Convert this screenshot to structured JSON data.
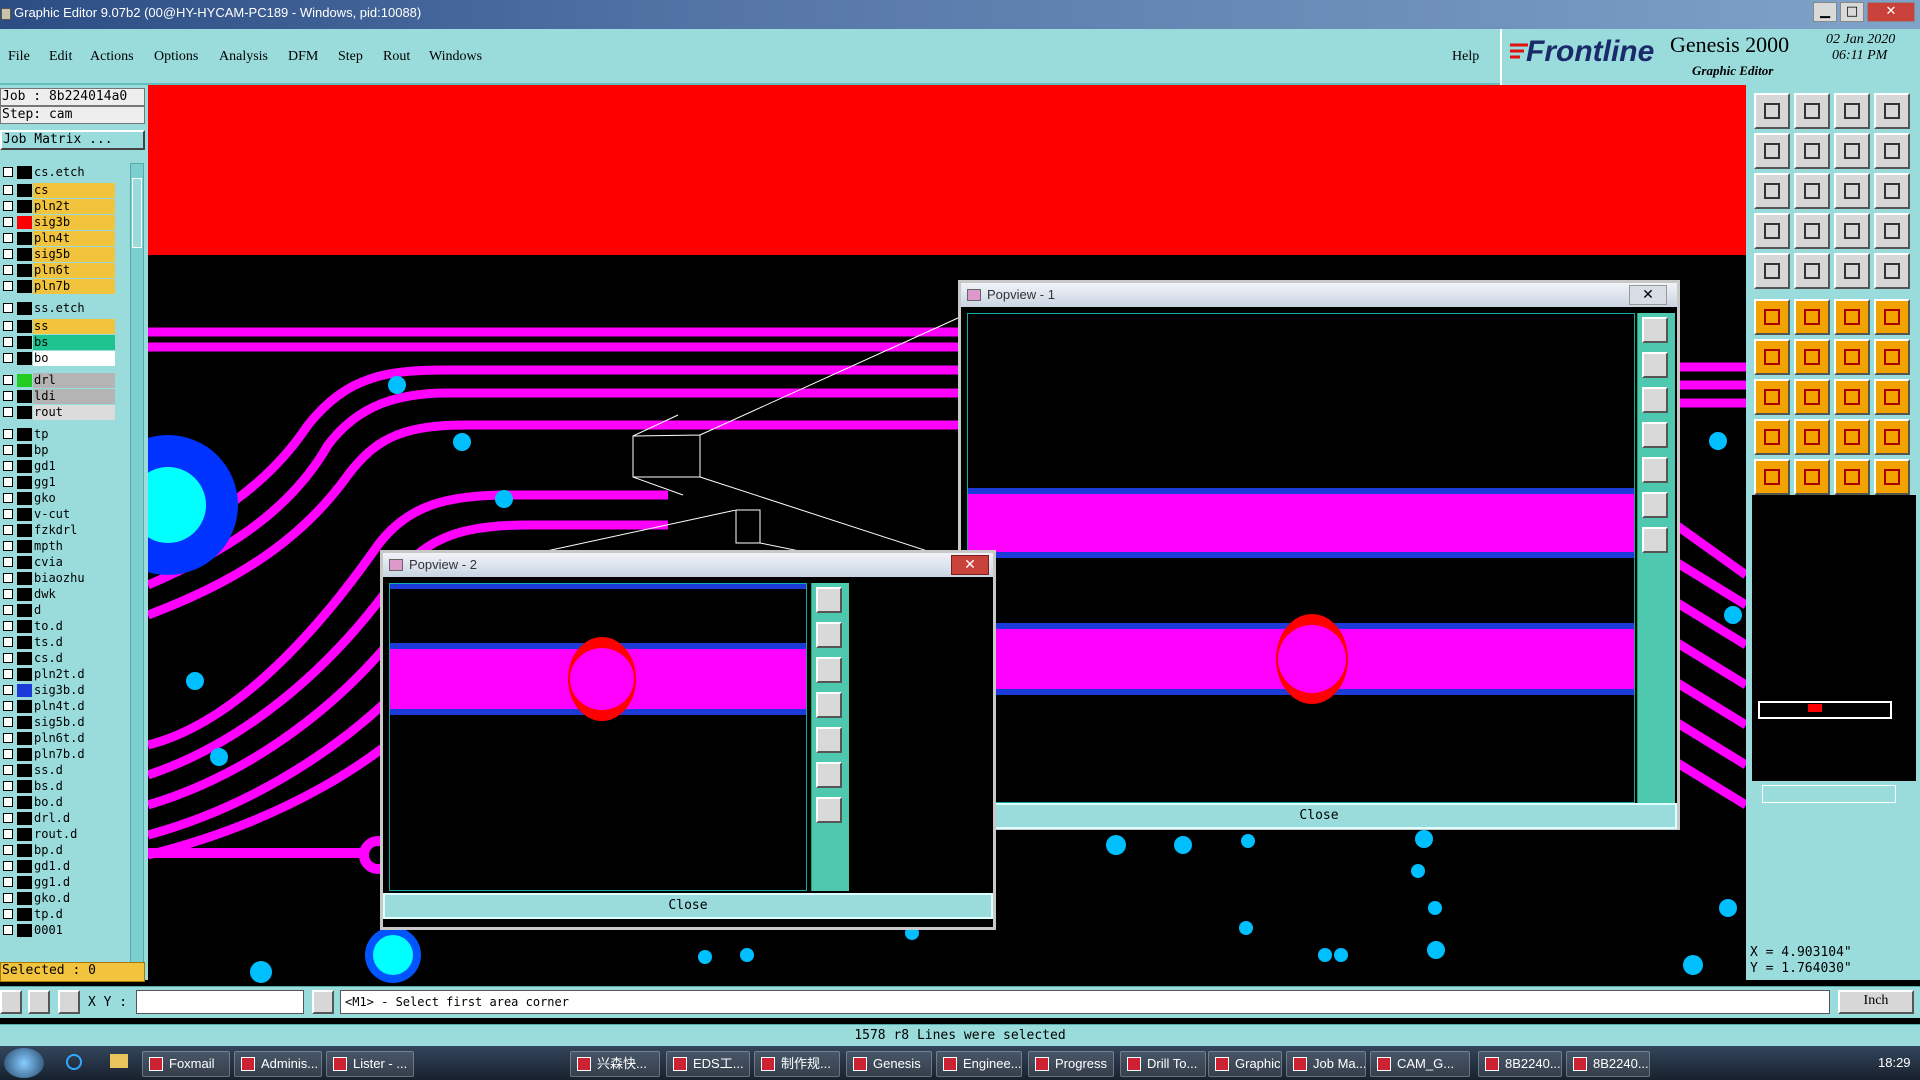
{
  "window": {
    "title": "Graphic Editor 9.07b2 (00@HY-HYCAM-PC189 - Windows, pid:10088)",
    "min": "▁",
    "max": "□",
    "close": "✕"
  },
  "menu": {
    "items": [
      "File",
      "Edit",
      "Actions",
      "Options",
      "Analysis",
      "DFM",
      "Step",
      "Rout",
      "Windows"
    ],
    "help": "Help"
  },
  "brand": {
    "logo": "Frontline",
    "product": "Genesis 2000",
    "subtitle": "Graphic Editor",
    "date": "02 Jan 2020",
    "time": "06:11 PM"
  },
  "job": {
    "job_line": "Job : 8b224014a0",
    "step_line": "Step: cam",
    "matrix_button": "Job Matrix ..."
  },
  "layers": [
    {
      "name": "cs.etch",
      "color": "#9adcdc",
      "swatch": "#000000"
    },
    {
      "name": "cs",
      "color": "#f2c33c",
      "swatch": "#000000"
    },
    {
      "name": "pln2t",
      "color": "#f2c33c",
      "swatch": "#000000"
    },
    {
      "name": "sig3b",
      "color": "#f2c33c",
      "swatch": "#ff0000"
    },
    {
      "name": "pln4t",
      "color": "#f2c33c",
      "swatch": "#000000"
    },
    {
      "name": "sig5b",
      "color": "#f2c33c",
      "swatch": "#000000"
    },
    {
      "name": "pln6t",
      "color": "#f2c33c",
      "swatch": "#000000"
    },
    {
      "name": "pln7b",
      "color": "#f2c33c",
      "swatch": "#000000"
    },
    {
      "name": "ss.etch",
      "color": "#9adcdc",
      "swatch": "#000000"
    },
    {
      "name": "ss",
      "color": "#f2c33c",
      "swatch": "#000000"
    },
    {
      "name": "bs",
      "color": "#1ec38f",
      "swatch": "#000000"
    },
    {
      "name": "bo",
      "color": "#ffffff",
      "swatch": "#000000"
    },
    {
      "name": "drl",
      "color": "#b4b4b4",
      "swatch": "#22cc22"
    },
    {
      "name": "ldi",
      "color": "#b4b4b4",
      "swatch": "#000000"
    },
    {
      "name": "rout",
      "color": "#dcdcdc",
      "swatch": "#000000"
    },
    {
      "name": "tp",
      "color": "#9adcdc",
      "swatch": "#000000"
    },
    {
      "name": "bp",
      "color": "#9adcdc",
      "swatch": "#000000"
    },
    {
      "name": "gd1",
      "color": "#9adcdc",
      "swatch": "#000000"
    },
    {
      "name": "gg1",
      "color": "#9adcdc",
      "swatch": "#000000"
    },
    {
      "name": "gko",
      "color": "#9adcdc",
      "swatch": "#000000"
    },
    {
      "name": "v-cut",
      "color": "#9adcdc",
      "swatch": "#000000"
    },
    {
      "name": "fzkdrl",
      "color": "#9adcdc",
      "swatch": "#000000"
    },
    {
      "name": "mpth",
      "color": "#9adcdc",
      "swatch": "#000000"
    },
    {
      "name": "cvia",
      "color": "#9adcdc",
      "swatch": "#000000"
    },
    {
      "name": "biaozhu",
      "color": "#9adcdc",
      "swatch": "#000000"
    },
    {
      "name": "dwk",
      "color": "#9adcdc",
      "swatch": "#000000"
    },
    {
      "name": "d",
      "color": "#9adcdc",
      "swatch": "#000000"
    },
    {
      "name": "to.d",
      "color": "#9adcdc",
      "swatch": "#000000"
    },
    {
      "name": "ts.d",
      "color": "#9adcdc",
      "swatch": "#000000"
    },
    {
      "name": "cs.d",
      "color": "#9adcdc",
      "swatch": "#000000"
    },
    {
      "name": "pln2t.d",
      "color": "#9adcdc",
      "swatch": "#000000"
    },
    {
      "name": "sig3b.d",
      "color": "#9adcdc",
      "swatch": "#1d3bd8"
    },
    {
      "name": "pln4t.d",
      "color": "#9adcdc",
      "swatch": "#000000"
    },
    {
      "name": "sig5b.d",
      "color": "#9adcdc",
      "swatch": "#000000"
    },
    {
      "name": "pln6t.d",
      "color": "#9adcdc",
      "swatch": "#000000"
    },
    {
      "name": "pln7b.d",
      "color": "#9adcdc",
      "swatch": "#000000"
    },
    {
      "name": "ss.d",
      "color": "#9adcdc",
      "swatch": "#000000"
    },
    {
      "name": "bs.d",
      "color": "#9adcdc",
      "swatch": "#000000"
    },
    {
      "name": "bo.d",
      "color": "#9adcdc",
      "swatch": "#000000"
    },
    {
      "name": "drl.d",
      "color": "#9adcdc",
      "swatch": "#000000"
    },
    {
      "name": "rout.d",
      "color": "#9adcdc",
      "swatch": "#000000"
    },
    {
      "name": "bp.d",
      "color": "#9adcdc",
      "swatch": "#000000"
    },
    {
      "name": "gd1.d",
      "color": "#9adcdc",
      "swatch": "#000000"
    },
    {
      "name": "gg1.d",
      "color": "#9adcdc",
      "swatch": "#000000"
    },
    {
      "name": "gko.d",
      "color": "#9adcdc",
      "swatch": "#000000"
    },
    {
      "name": "tp.d",
      "color": "#9adcdc",
      "swatch": "#000000"
    },
    {
      "name": "0001",
      "color": "#9adcdc",
      "swatch": "#000000"
    }
  ],
  "selected": "Selected : 0",
  "popups": [
    {
      "title": "Popview - 1",
      "close_label": "Close"
    },
    {
      "title": "Popview - 2",
      "close_label": "Close"
    }
  ],
  "coords": {
    "x": "X = 4.903104\"",
    "y": "Y = 1.764030\""
  },
  "bottom": {
    "xy_label": "X Y :",
    "xy_value": "",
    "prompt": "<M1> - Select first area corner",
    "units": "Inch"
  },
  "status": "1578 r8 Lines were selected",
  "taskbar": {
    "items": [
      "Foxmail",
      "Adminis...",
      "Lister - ...",
      "兴森快...",
      "EDS工...",
      "制作规...",
      "Genesis",
      "Enginee...",
      "Progress",
      "Drill To...",
      "Graphic...",
      "Job Ma...",
      "CAM_G...",
      "8B2240...",
      "8B2240..."
    ],
    "clock": "18:29"
  },
  "colors": {
    "panel": "#9adcdc",
    "trace": "#ff00ff",
    "via": "#00bfff",
    "red": "#ff0000",
    "blue": "#1d3bd8"
  }
}
